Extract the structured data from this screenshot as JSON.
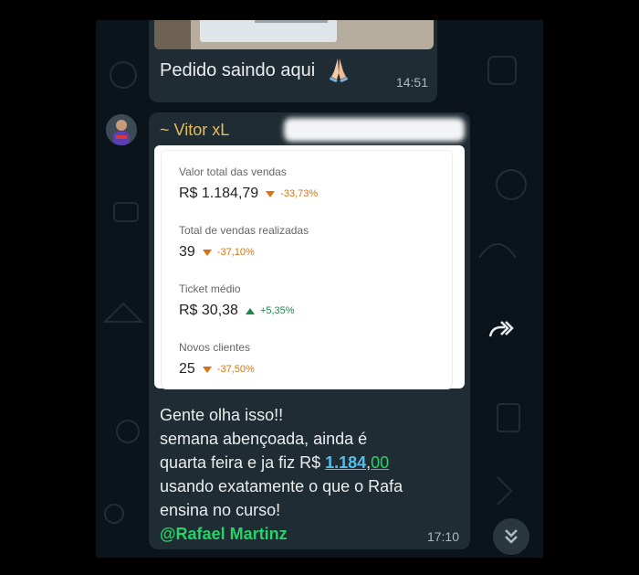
{
  "messages": {
    "first": {
      "text": "Pedido saindo aqui",
      "emoji": "🙏",
      "time": "14:51"
    },
    "second": {
      "sender": "~ Vitor xL",
      "time": "17:10",
      "lines": [
        "Gente olha isso!!",
        "semana abençoada, ainda é",
        "quarta feira e ja fiz R$ ",
        "usando exatamente o que o Rafa",
        "ensina no curso!"
      ],
      "amount_main": "1.184",
      "amount_sep": ",",
      "amount_cents": "00",
      "mention": "@Rafael Martinz"
    }
  },
  "stats_card": {
    "metrics": [
      {
        "label": "Valor total das vendas",
        "value": "R$ 1.184,79",
        "change": "-33,73%",
        "direction": "down"
      },
      {
        "label": "Total de vendas realizadas",
        "value": "39",
        "change": "-37,10%",
        "direction": "down"
      },
      {
        "label": "Ticket médio",
        "value": "R$ 30,38",
        "change": "+5,35%",
        "direction": "up"
      },
      {
        "label": "Novos clientes",
        "value": "25",
        "change": "-37,50%",
        "direction": "down"
      }
    ]
  },
  "colors": {
    "chat_bg": "#0b141a",
    "bubble": "#202c33",
    "sender": "#e6bd5a",
    "link": "#53bdeb",
    "mention": "#25d366",
    "down": "#d9730d",
    "up": "#1a8a4a"
  },
  "icons": {
    "forward": "forward-icon",
    "scroll": "double-chevron-down-icon",
    "emoji": "praying-hands-icon"
  }
}
